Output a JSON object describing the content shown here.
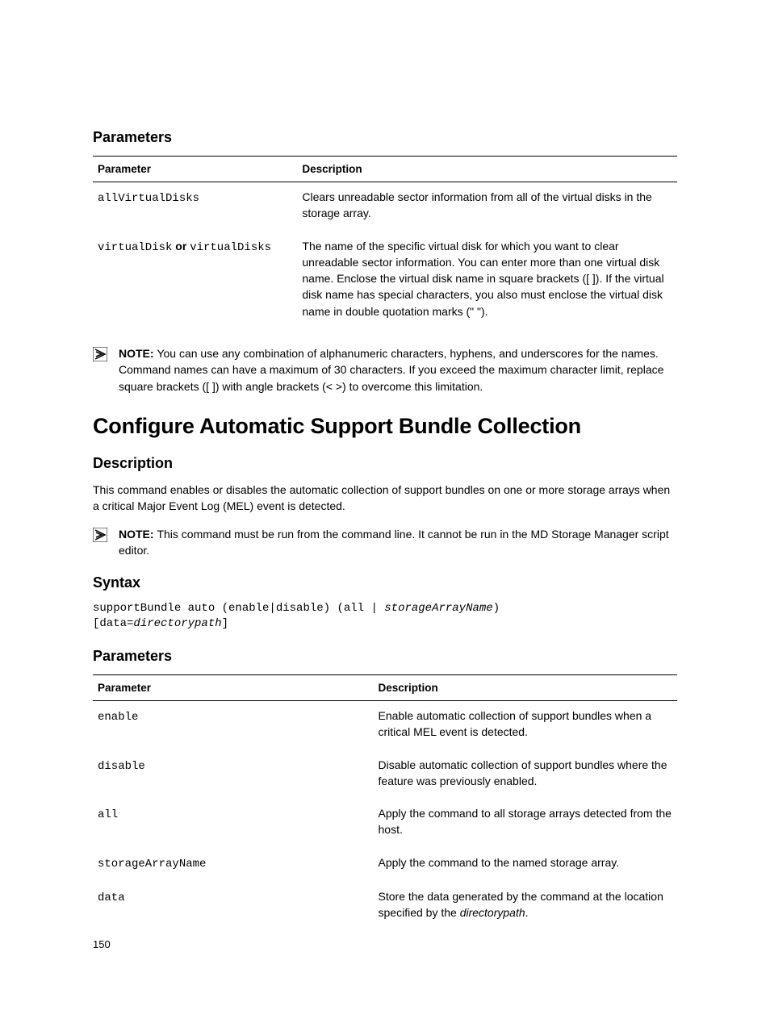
{
  "sections": {
    "parameters1": {
      "heading": "Parameters",
      "cols": {
        "param": "Parameter",
        "desc": "Description"
      },
      "rows": [
        {
          "param_mono": "allVirtualDisks",
          "desc": "Clears unreadable sector information from all of the virtual disks in the storage array."
        },
        {
          "param_mono_1": "virtualDisk",
          "param_or": " or ",
          "param_mono_2": "virtualDisks",
          "desc": "The name of the specific virtual disk for which you want to clear unreadable sector information. You can enter more than one virtual disk name. Enclose the virtual disk name in square brackets ([ ]). If the virtual disk name has special characters, you also must enclose the virtual disk name in double quotation marks (\" \")."
        }
      ]
    },
    "note1": {
      "label": "NOTE: ",
      "text": "You can use any combination of alphanumeric characters, hyphens, and underscores for the names. Command names can have a maximum of 30 characters. If you exceed the maximum character limit, replace square brackets ([ ]) with angle brackets (< >) to overcome this limitation."
    },
    "title": "Configure Automatic Support Bundle Collection",
    "description": {
      "heading": "Description",
      "text": "This command enables or disables the automatic collection of support bundles on one or more storage arrays when a critical Major Event Log (MEL) event is detected."
    },
    "note2": {
      "label": "NOTE: ",
      "text": "This command must be run from the command line. It cannot be run in the MD Storage Manager script editor."
    },
    "syntax": {
      "heading": "Syntax",
      "line1_a": "supportBundle auto (enable|disable) (all | ",
      "line1_b": "storageArrayName",
      "line1_c": ")",
      "line2_a": "[data=",
      "line2_b": "directorypath",
      "line2_c": "]"
    },
    "parameters2": {
      "heading": "Parameters",
      "cols": {
        "param": "Parameter",
        "desc": "Description"
      },
      "rows": [
        {
          "param": "enable",
          "desc": "Enable automatic collection of support bundles when a critical MEL event is detected."
        },
        {
          "param": "disable",
          "desc": "Disable automatic collection of support bundles where the feature was previously enabled."
        },
        {
          "param": "all",
          "desc": "Apply the command to all storage arrays detected from the host."
        },
        {
          "param": "storageArrayName",
          "desc": "Apply the command to the named storage array."
        },
        {
          "param": "data",
          "desc_a": "Store the data generated by the command at the location specified by the ",
          "desc_b": "directorypath",
          "desc_c": "."
        }
      ]
    }
  },
  "page_number": "150"
}
